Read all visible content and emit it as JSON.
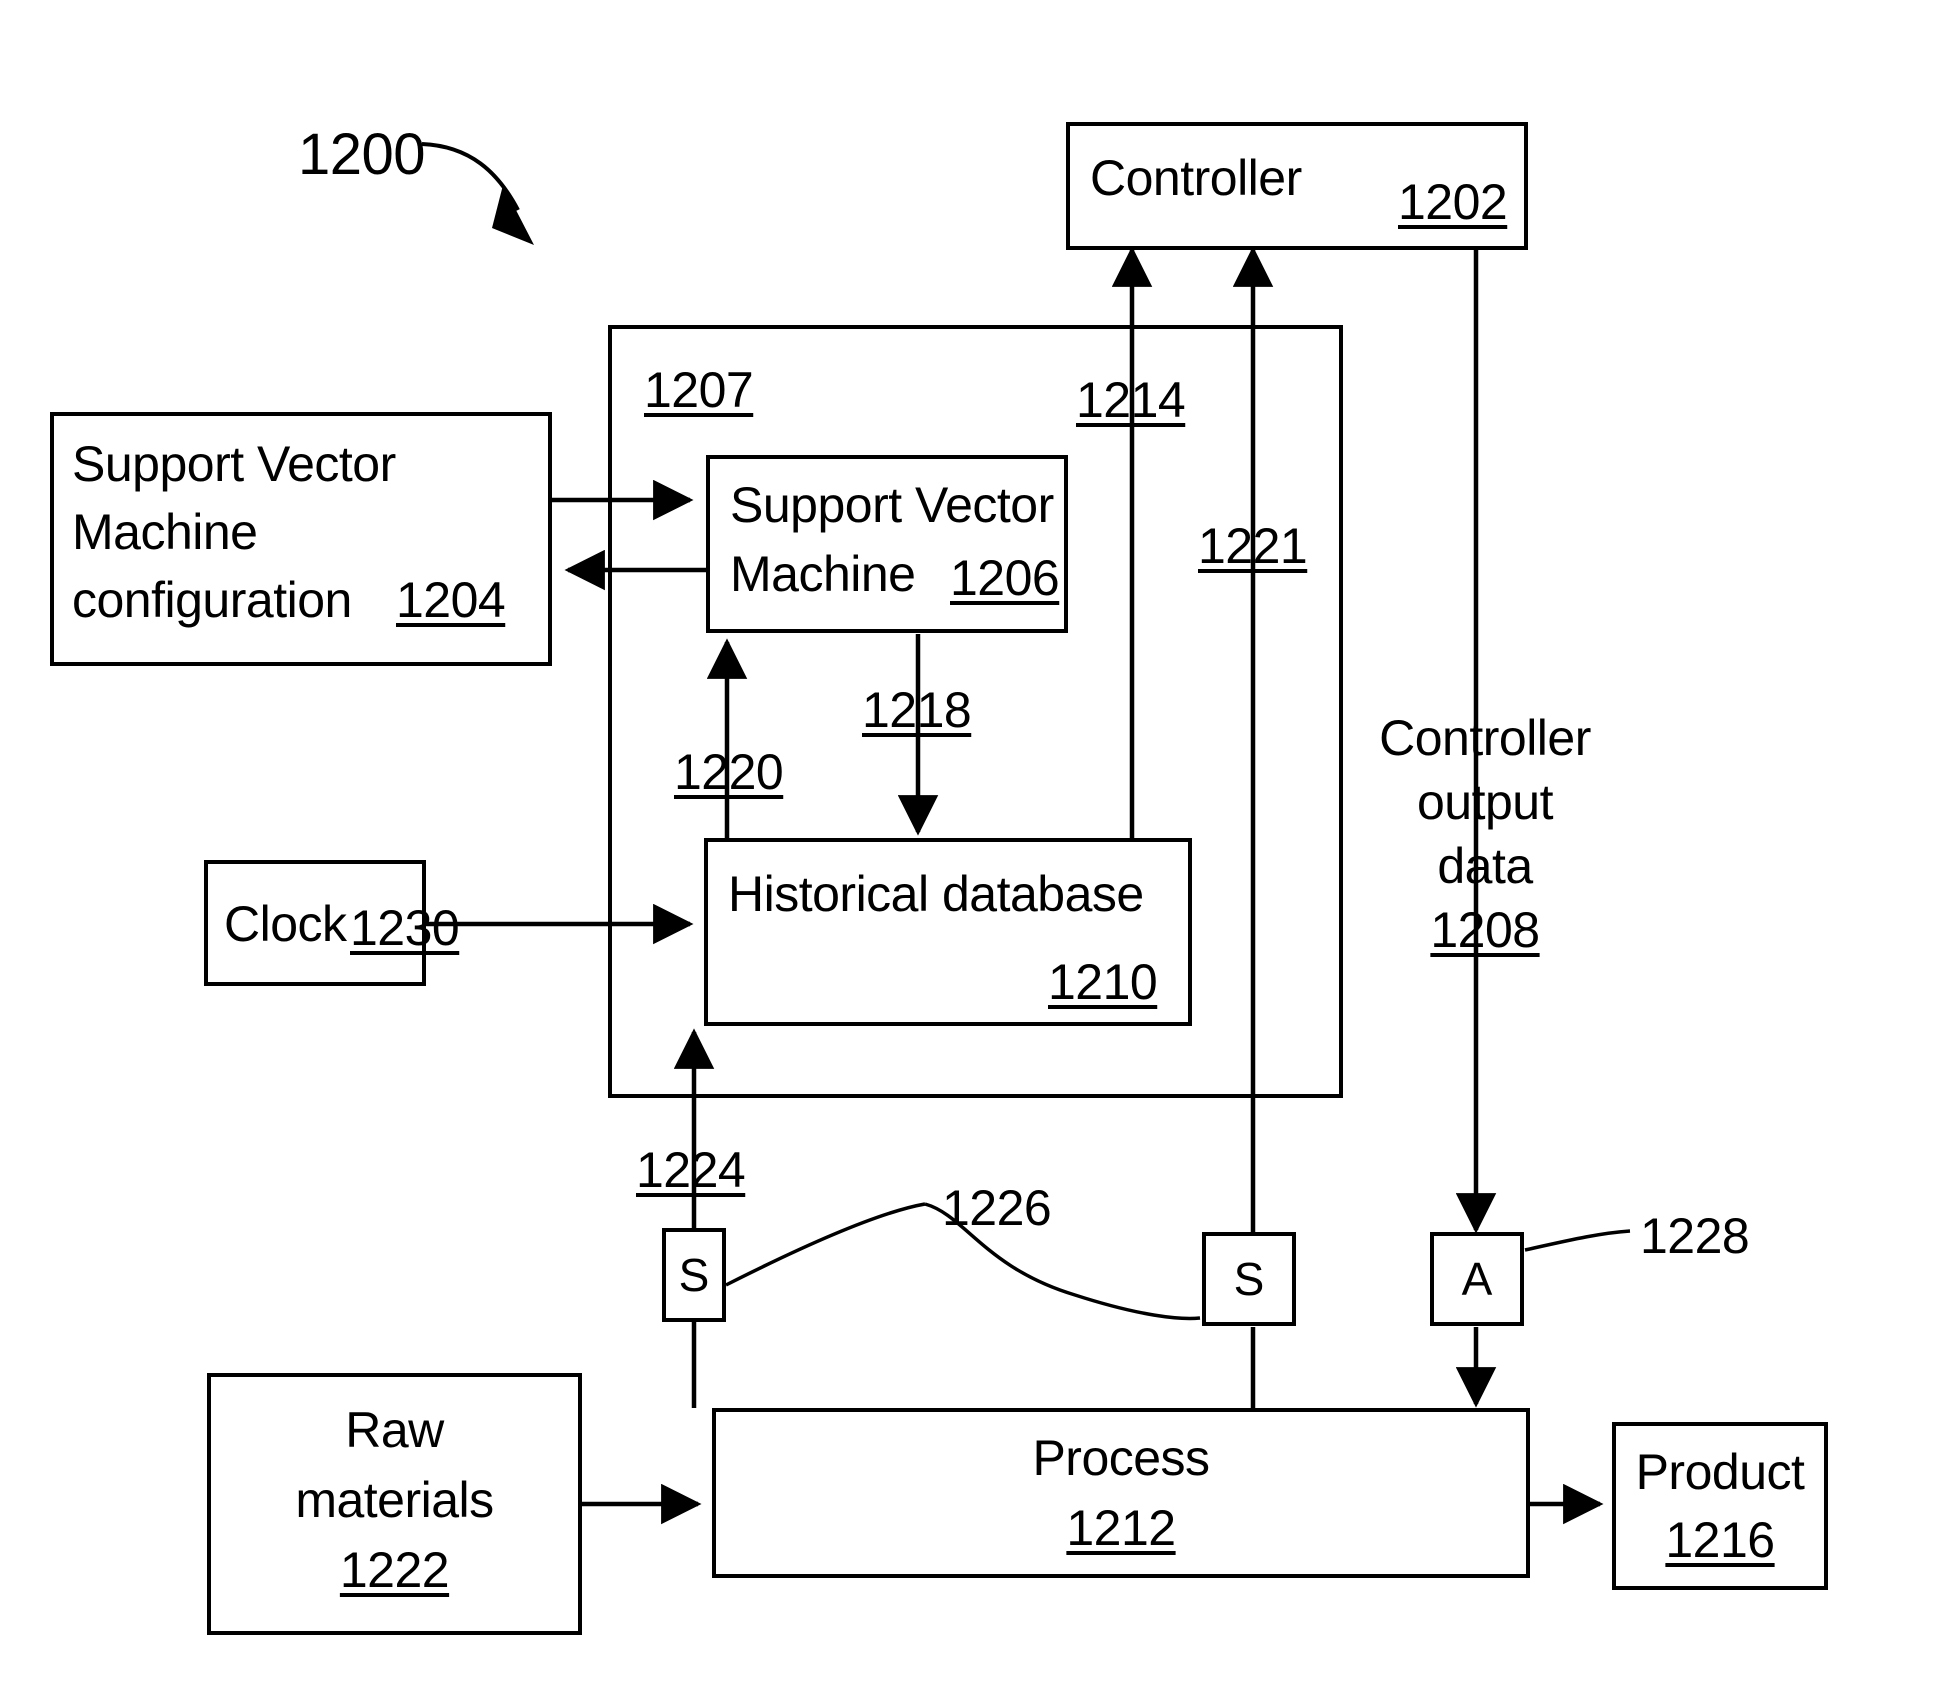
{
  "figure": {
    "number": "1200",
    "kind": "patent-block-diagram"
  },
  "blocks": {
    "controller": {
      "label": "Controller",
      "ref": "1202"
    },
    "svm_configuration": {
      "line1": "Support Vector",
      "line2": "Machine",
      "line3": "configuration",
      "ref": "1204"
    },
    "svm": {
      "line1": "Support Vector",
      "line2": "Machine",
      "ref": "1206"
    },
    "container": {
      "ref": "1207"
    },
    "historical_db": {
      "label": "Historical database",
      "ref": "1210"
    },
    "clock": {
      "label": "Clock",
      "ref": "1230"
    },
    "process": {
      "label": "Process",
      "ref": "1212"
    },
    "raw_materials": {
      "line1": "Raw",
      "line2": "materials",
      "ref": "1222"
    },
    "product": {
      "label": "Product",
      "ref": "1216"
    }
  },
  "annotations": {
    "controller_output_data": {
      "line1": "Controller",
      "line2": "output",
      "line3": "data",
      "ref": "1208"
    }
  },
  "connectors": {
    "svm_to_controller": "1214",
    "sensor_to_controller": "1221",
    "svm_to_historical_db": "1218",
    "historical_db_to_svm": "1220",
    "sensor_to_historical_db": "1224",
    "sensors": "1226",
    "actuator": "1228"
  },
  "devices": {
    "sensor_left": {
      "glyph": "S"
    },
    "sensor_right": {
      "glyph": "S"
    },
    "actuator": {
      "glyph": "A"
    }
  },
  "colors": {
    "stroke": "#000000",
    "background": "#ffffff"
  }
}
